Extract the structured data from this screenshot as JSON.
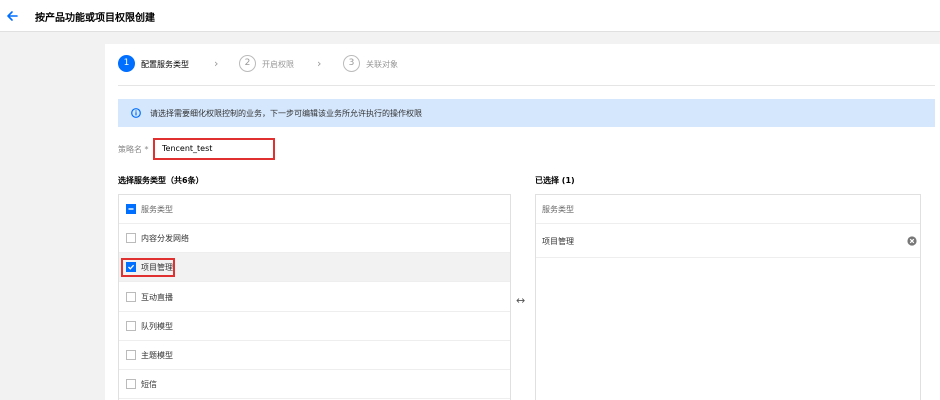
{
  "header": {
    "title": "按产品功能或项目权限创建"
  },
  "steps": [
    {
      "number": "1",
      "label": "配置服务类型",
      "active": true
    },
    {
      "number": "2",
      "label": "开启权限",
      "active": false
    },
    {
      "number": "3",
      "label": "关联对象",
      "active": false
    }
  ],
  "notice": {
    "text": "请选择需要细化权限控制的业务，下一步可编辑该业务所允许执行的操作权限"
  },
  "policy": {
    "label": "策略名 *",
    "value": "Tencent_test"
  },
  "left_panel": {
    "title": "选择服务类型（共6条）",
    "header_label": "服务类型",
    "items": [
      {
        "label": "内容分发网络",
        "checked": false
      },
      {
        "label": "项目管理",
        "checked": true
      },
      {
        "label": "互动直播",
        "checked": false
      },
      {
        "label": "队列模型",
        "checked": false
      },
      {
        "label": "主题模型",
        "checked": false
      },
      {
        "label": "短信",
        "checked": false
      }
    ]
  },
  "right_panel": {
    "title": "已选择 (1)",
    "header_label": "服务类型",
    "items": [
      {
        "label": "项目管理"
      }
    ]
  },
  "colors": {
    "accent": "#006eff",
    "highlight": "#e03030",
    "notice_bg": "#d5e7fd"
  },
  "icons": {
    "back": "back-arrow-icon",
    "info": "info-icon",
    "swap": "swap-arrows-icon",
    "remove": "remove-icon",
    "step_chevron": "chevron-right-icon"
  }
}
